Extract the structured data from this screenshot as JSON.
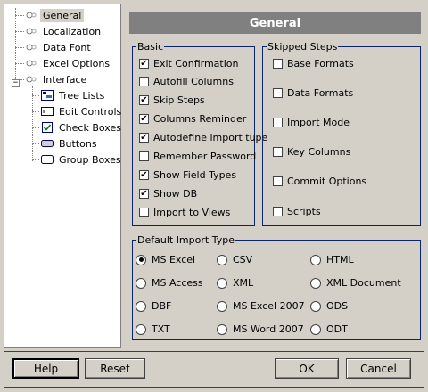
{
  "tree": {
    "items": [
      {
        "label": "General",
        "icon": "settings-icon",
        "selected": true
      },
      {
        "label": "Localization",
        "icon": "settings-icon"
      },
      {
        "label": "Data Font",
        "icon": "settings-icon"
      },
      {
        "label": "Excel Options",
        "icon": "settings-icon"
      },
      {
        "label": "Interface",
        "icon": "settings-icon",
        "expanded": true
      }
    ],
    "children": [
      {
        "label": "Tree Lists",
        "icon": "tree-list-icon"
      },
      {
        "label": "Edit Controls",
        "icon": "edit-control-icon"
      },
      {
        "label": "Check Boxes",
        "icon": "checkbox-icon"
      },
      {
        "label": "Buttons",
        "icon": "button-icon"
      },
      {
        "label": "Group Boxes",
        "icon": "group-box-icon"
      }
    ]
  },
  "header": {
    "title": "General"
  },
  "basic": {
    "legend": "Basic",
    "options": [
      {
        "label": "Exit Confirmation",
        "checked": true
      },
      {
        "label": "Autofill Columns",
        "checked": false
      },
      {
        "label": "Skip Steps",
        "checked": true
      },
      {
        "label": "Columns Reminder",
        "checked": true
      },
      {
        "label": "Autodefine import tupe",
        "checked": true
      },
      {
        "label": "Remember Password",
        "checked": false
      },
      {
        "label": "Show Field Types",
        "checked": true
      },
      {
        "label": "Show DB",
        "checked": true
      },
      {
        "label": "Import to Views",
        "checked": false
      }
    ]
  },
  "skipped": {
    "legend": "Skipped Steps",
    "options": [
      {
        "label": "Base Formats",
        "checked": false
      },
      {
        "label": "Data Formats",
        "checked": false
      },
      {
        "label": "Import Mode",
        "checked": false
      },
      {
        "label": "Key Columns",
        "checked": false
      },
      {
        "label": "Commit Options",
        "checked": false
      },
      {
        "label": "Scripts",
        "checked": false
      }
    ]
  },
  "import_type": {
    "legend": "Default Import Type",
    "selected": "MS Excel",
    "options": [
      [
        "MS Excel",
        "CSV",
        "HTML"
      ],
      [
        "MS Access",
        "XML",
        "XML Document"
      ],
      [
        "DBF",
        "MS Excel 2007",
        "ODS"
      ],
      [
        "TXT",
        "MS Word 2007",
        "ODT"
      ]
    ]
  },
  "buttons": {
    "help": "Help",
    "reset": "Reset",
    "ok": "OK",
    "cancel": "Cancel"
  },
  "colors": {
    "header_bg": "#808080",
    "group_border": "#0a246a",
    "dialog_bg": "#d4d0c8"
  }
}
